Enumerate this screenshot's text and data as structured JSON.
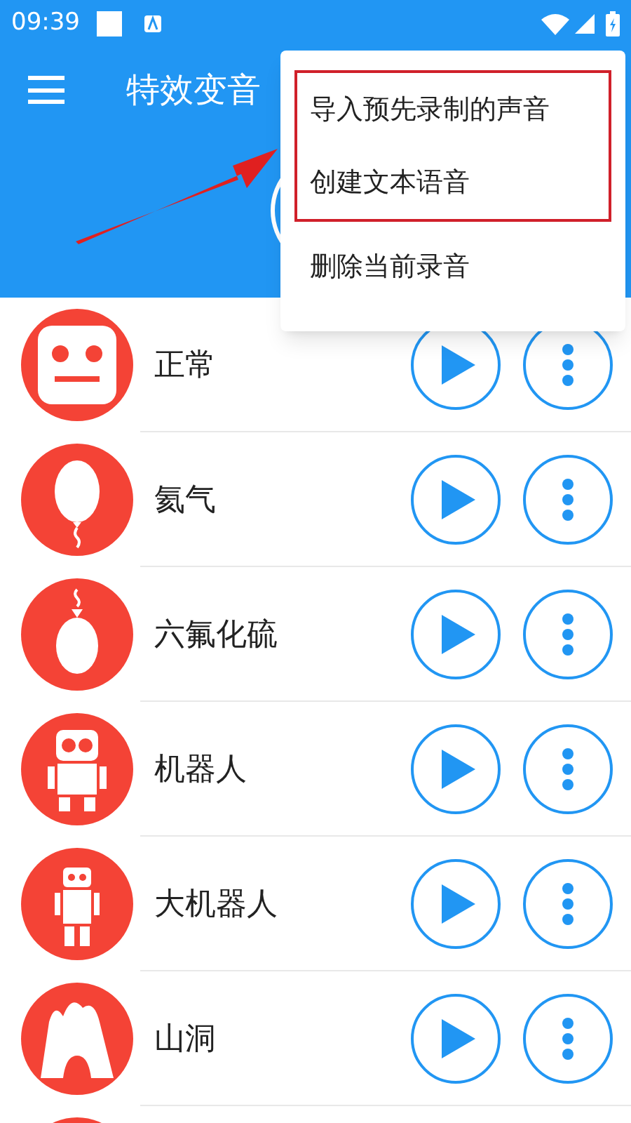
{
  "status_bar": {
    "time": "09:39"
  },
  "toolbar": {
    "title": "特效变音"
  },
  "menu": {
    "framed_items": [
      {
        "label": "导入预先录制的声音"
      },
      {
        "label": "创建文本语音"
      }
    ],
    "items": [
      {
        "label": "删除当前录音"
      }
    ]
  },
  "effects": [
    {
      "name": "正常"
    },
    {
      "name": "氦气"
    },
    {
      "name": "六氟化硫"
    },
    {
      "name": "机器人"
    },
    {
      "name": "大机器人"
    },
    {
      "name": "山洞"
    }
  ]
}
